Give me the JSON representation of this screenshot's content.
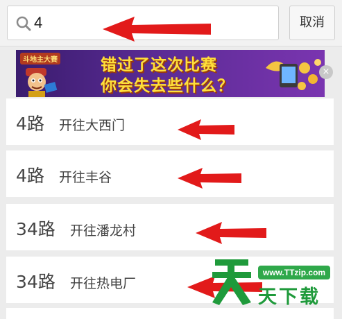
{
  "search": {
    "value": "4"
  },
  "cancel_label": "取消",
  "banner": {
    "badge": "斗地主大赛",
    "line1": "错过了这次比赛",
    "line2": "你会失去些什么？",
    "close_glyph": "×"
  },
  "routes": [
    {
      "number": "4路",
      "destination": "开往大西门"
    },
    {
      "number": "4路",
      "destination": "开往丰谷"
    },
    {
      "number": "34路",
      "destination": "开往潘龙村"
    },
    {
      "number": "34路",
      "destination": "开往热电厂"
    }
  ],
  "watermark": {
    "url": "www.TTzip.com",
    "text": "天下载"
  },
  "colors": {
    "arrow": "#e21a1a",
    "watermark": "#1f9a3b",
    "banner": "#5a2b94"
  }
}
